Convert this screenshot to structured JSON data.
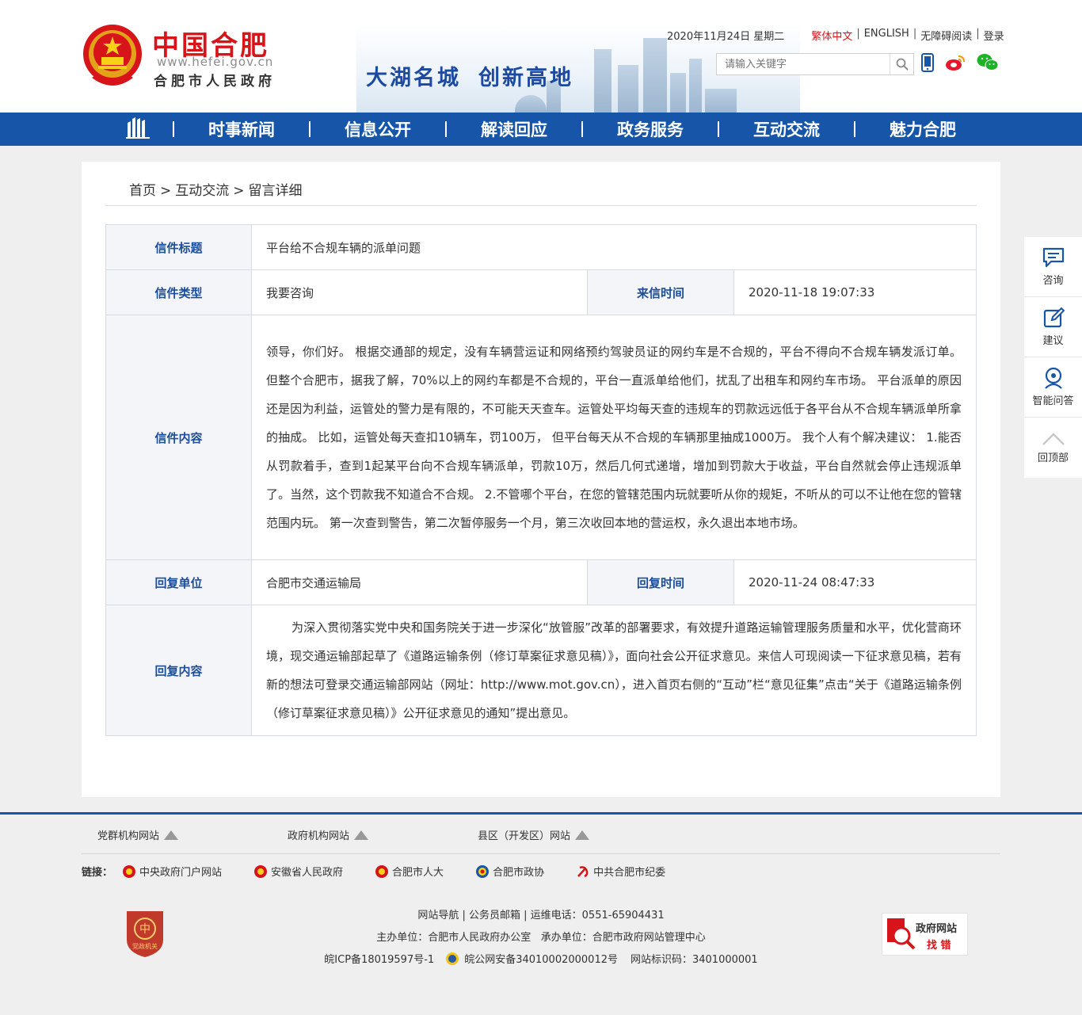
{
  "header": {
    "brand_title": "中国合肥",
    "brand_url": "www.hefei.gov.cn",
    "brand_subtitle": "合肥市人民政府",
    "slogan_left": "大湖名城",
    "slogan_right": "创新高地",
    "date": "2020年11月24日 星期二",
    "links": {
      "traditional": "繁体中文",
      "english": "ENGLISH",
      "accessible": "无障碍阅读",
      "login": "登录"
    },
    "search_placeholder": "请输入关键字"
  },
  "nav": {
    "items": [
      "时事新闻",
      "信息公开",
      "解读回应",
      "政务服务",
      "互动交流",
      "魅力合肥"
    ]
  },
  "breadcrumb": [
    "首页",
    "互动交流",
    "留言详细"
  ],
  "letter": {
    "title_label": "信件标题",
    "title": "平台给不合规车辆的派单问题",
    "type_label": "信件类型",
    "type": "我要咨询",
    "time_label": "来信时间",
    "time": "2020-11-18 19:07:33",
    "content_label": "信件内容",
    "content": "领导，你们好。 根据交通部的规定，没有车辆营运证和网络预约驾驶员证的网约车是不合规的，平台不得向不合规车辆发派订单。 但整个合肥市，据我了解，70%以上的网约车都是不合规的，平台一直派单给他们，扰乱了出租车和网约车市场。 平台派单的原因还是因为利益，运管处的警力是有限的，不可能天天查车。运管处平均每天查的违规车的罚款远远低于各平台从不合规车辆派单所拿的抽成。 比如，运管处每天查扣10辆车，罚100万， 但平台每天从不合规的车辆那里抽成1000万。 我个人有个解决建议： 1.能否从罚款着手，查到1起某平台向不合规车辆派单，罚款10万，然后几何式递增，增加到罚款大于收益，平台自然就会停止违规派单了。当然，这个罚款我不知道合不合规。 2.不管哪个平台，在您的管辖范围内玩就要听从你的规矩，不听从的可以不让他在您的管辖范围内玩。 第一次查到警告，第二次暂停服务一个月，第三次收回本地的营运权，永久退出本地市场。",
    "reply_unit_label": "回复单位",
    "reply_unit": "合肥市交通运输局",
    "reply_time_label": "回复时间",
    "reply_time": "2020-11-24 08:47:33",
    "reply_content_label": "回复内容",
    "reply_content": "为深入贯彻落实党中央和国务院关于进一步深化“放管服”改革的部署要求，有效提升道路运输管理服务质量和水平，优化营商环境，现交通运输部起草了《道路运输条例（修订草案征求意见稿）》，面向社会公开征求意见。来信人可现阅读一下征求意见稿，若有新的想法可登录交通运输部网站（网址：http://www.mot.gov.cn），进入首页右侧的“互动”栏“意见征集”点击“关于《道路运输条例（修订草案征求意见稿）》公开征求意见的通知”提出意见。"
  },
  "sidebar": [
    "咨询",
    "建议",
    "智能问答",
    "回顶部"
  ],
  "footer": {
    "site_groups": [
      "党群机构网站",
      "政府机构网站",
      "县区（开发区）网站"
    ],
    "links_title": "链接：",
    "links": [
      "中央政府门户网站",
      "安徽省人民政府",
      "合肥市人大",
      "合肥市政协",
      "中共合肥市纪委"
    ],
    "line1": "网站导航 | 公务员邮箱 | 运维电话：0551-65904431",
    "line2": "主办单位：合肥市人民政府办公室   承办单位：合肥市政府网站管理中心",
    "icp": "皖ICP备18019597号-1",
    "police": "皖公网安备34010002000012号",
    "site_code": "网站标识码：3401000001",
    "badge_left": "党政机关",
    "badge_right_top": "政府网站",
    "badge_right_bottom": "找 错"
  },
  "colors": {
    "brand_red": "#d7141a",
    "nav_blue": "#1655a8",
    "label_blue": "#1b4d9b"
  }
}
